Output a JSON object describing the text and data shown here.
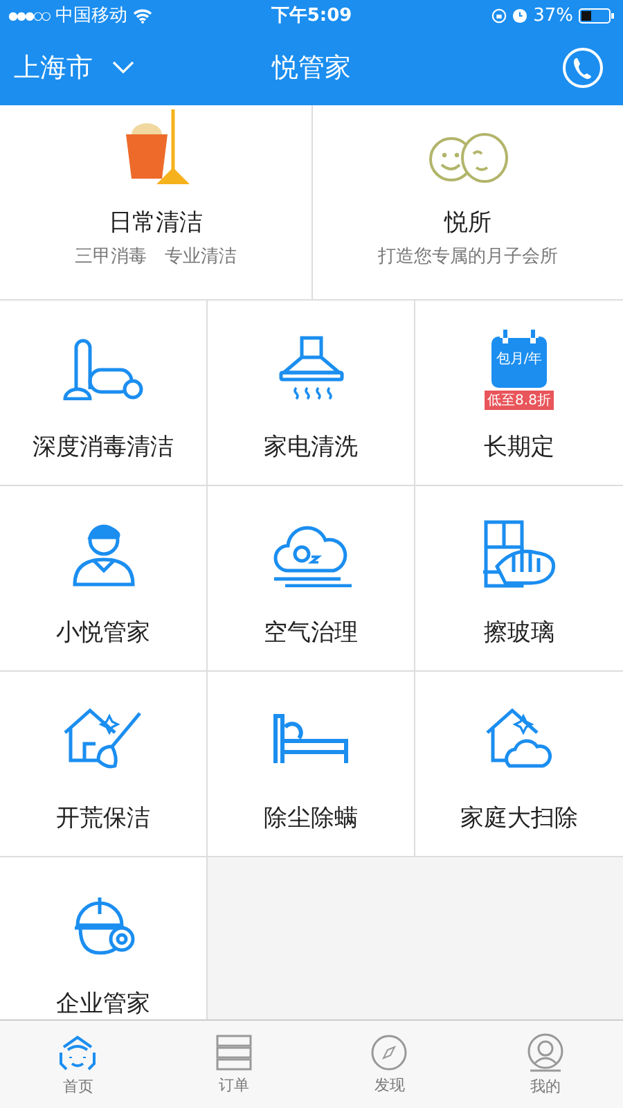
{
  "status_bar": {
    "signal": "●●●○○",
    "carrier": "中国移动",
    "time": "下午5:09",
    "battery": "37%"
  },
  "nav_bar": {
    "city": "上海市",
    "title": "悦管家"
  },
  "featured": [
    {
      "title": "日常清洁",
      "subtitle": "三甲消毒　专业清洁"
    },
    {
      "title": "悦所",
      "subtitle": "打造您专属的月子会所"
    }
  ],
  "services": [
    {
      "label": "深度消毒清洁"
    },
    {
      "label": "家电清洗"
    },
    {
      "label": "长期定",
      "calendar_text": "包月/年",
      "badge": "低至8.8折"
    },
    {
      "label": "小悦管家"
    },
    {
      "label": "空气治理"
    },
    {
      "label": "擦玻璃"
    },
    {
      "label": "开荒保洁"
    },
    {
      "label": "除尘除螨"
    },
    {
      "label": "家庭大扫除"
    },
    {
      "label": "企业管家"
    }
  ],
  "tab_bar": [
    {
      "label": "首页",
      "selected": true
    },
    {
      "label": "订单",
      "selected": false
    },
    {
      "label": "发现",
      "selected": false
    },
    {
      "label": "我的",
      "selected": false
    }
  ]
}
